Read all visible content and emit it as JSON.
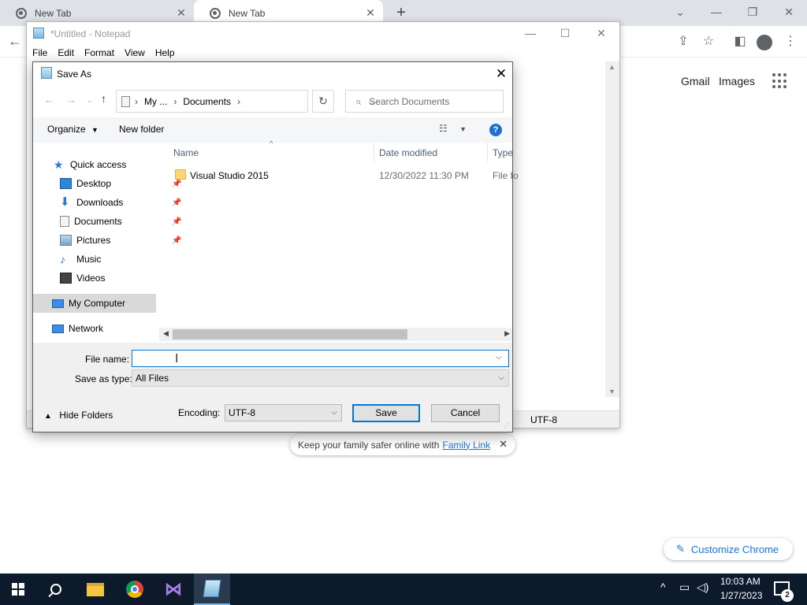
{
  "chrome": {
    "tabs": [
      {
        "label": "New Tab"
      },
      {
        "label": "New Tab"
      }
    ],
    "new_tab": "+",
    "links": {
      "gmail": "Gmail",
      "images": "Images"
    },
    "family_link": {
      "text": "Keep your family safer online with",
      "link": "Family Link"
    },
    "customize": "Customize Chrome"
  },
  "notepad": {
    "title": "*Untitled - Notepad",
    "menu": [
      "File",
      "Edit",
      "Format",
      "View",
      "Help"
    ],
    "status_encoding": "UTF-8"
  },
  "dialog": {
    "title": "Save As",
    "breadcrumb": [
      "My ...",
      "Documents"
    ],
    "search_placeholder": "Search Documents",
    "toolbar": {
      "organize": "Organize",
      "new_folder": "New folder"
    },
    "nav": {
      "quick_access": "Quick access",
      "items": [
        {
          "label": "Desktop",
          "pinned": true,
          "icon": "desktop-icon"
        },
        {
          "label": "Downloads",
          "pinned": true,
          "icon": "downloads-icon"
        },
        {
          "label": "Documents",
          "pinned": true,
          "icon": "documents-icon"
        },
        {
          "label": "Pictures",
          "pinned": true,
          "icon": "pictures-icon"
        },
        {
          "label": "Music",
          "pinned": false,
          "icon": "music-icon"
        },
        {
          "label": "Videos",
          "pinned": false,
          "icon": "videos-icon"
        }
      ],
      "my_computer": "My Computer",
      "network": "Network"
    },
    "columns": {
      "name": "Name",
      "date": "Date modified",
      "type": "Type"
    },
    "files": [
      {
        "name": "Visual Studio 2015",
        "date": "12/30/2022 11:30 PM",
        "type": "File fo"
      }
    ],
    "file_name_label": "File name:",
    "file_name_value": "",
    "save_as_type_label": "Save as type:",
    "save_as_type_value": "All Files",
    "hide_folders": "Hide Folders",
    "encoding_label": "Encoding:",
    "encoding_value": "UTF-8",
    "save": "Save",
    "cancel": "Cancel"
  },
  "taskbar": {
    "time": "10:03 AM",
    "date": "1/27/2023",
    "notification_count": "2"
  },
  "colors": {
    "accent": "#0078d7",
    "taskbar": "#0c1a2c",
    "chrome_link": "#1a73e8"
  }
}
